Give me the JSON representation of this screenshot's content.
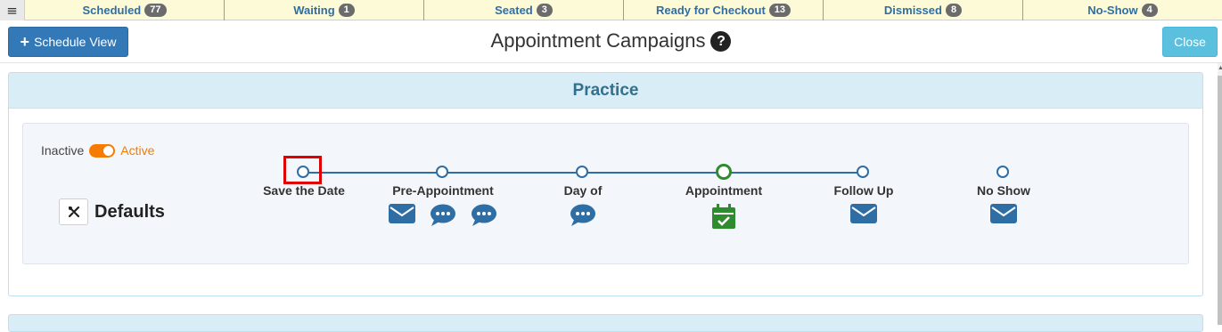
{
  "menu_icon": "hamburger-icon",
  "status_tabs": [
    {
      "label": "Scheduled",
      "count": "77"
    },
    {
      "label": "Waiting",
      "count": "1"
    },
    {
      "label": "Seated",
      "count": "3"
    },
    {
      "label": "Ready for Checkout",
      "count": "13"
    },
    {
      "label": "Dismissed",
      "count": "8"
    },
    {
      "label": "No-Show",
      "count": "4"
    }
  ],
  "header": {
    "schedule_view_label": "Schedule View",
    "title": "Appointment Campaigns",
    "help_icon": "?",
    "close_label": "Close"
  },
  "practice": {
    "heading": "Practice",
    "toggle": {
      "inactive_label": "Inactive",
      "active_label": "Active",
      "state": "active"
    },
    "defaults_label": "Defaults",
    "stages": [
      {
        "label": "Save the Date",
        "icons": []
      },
      {
        "label": "Pre-Appointment",
        "icons": [
          "envelope-icon",
          "chat-icon",
          "chat-icon"
        ]
      },
      {
        "label": "Day of",
        "icons": [
          "chat-icon"
        ]
      },
      {
        "label": "Appointment",
        "icons": [
          "calendar-check-icon"
        ]
      },
      {
        "label": "Follow Up",
        "icons": [
          "envelope-icon"
        ]
      },
      {
        "label": "No Show",
        "icons": [
          "envelope-icon"
        ]
      }
    ]
  },
  "colors": {
    "tab_bg": "#fdfad8",
    "tab_text": "#2f6ea5",
    "primary": "#3379b7",
    "close": "#5bc0de",
    "panel_header": "#d9edf7",
    "toggle_active": "#f57c00",
    "appointment_green": "#2e8b2e",
    "highlight": "#e00000"
  }
}
